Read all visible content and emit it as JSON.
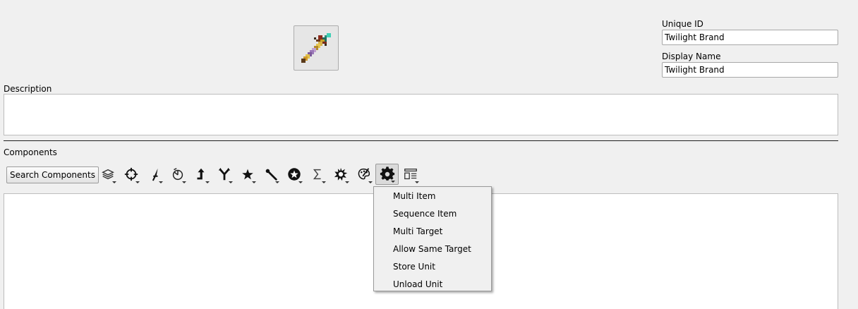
{
  "item": {
    "icon": "spear-sprite-icon",
    "unique_id_label": "Unique ID",
    "unique_id_value": "Twilight Brand",
    "display_name_label": "Display Name",
    "display_name_value": "Twilight Brand",
    "description_label": "Description",
    "description_value": ""
  },
  "components": {
    "label": "Components",
    "search_button": "Search Components",
    "toolbar_icons": [
      "layers-icon",
      "crosshair-icon",
      "sword-icon",
      "pie-clock-icon",
      "arrow-up-icon",
      "branch-icon",
      "star-icon",
      "staff-icon",
      "circle-star-icon",
      "sigma-icon",
      "burst-icon",
      "palette-icon",
      "gear-icon",
      "layout-icon"
    ],
    "active_tool": "gear-icon",
    "dropdown_menu": {
      "items": [
        "Multi Item",
        "Sequence Item",
        "Multi Target",
        "Allow Same Target",
        "Store Unit",
        "Unload Unit"
      ]
    }
  },
  "colors": {
    "background": "#f0f0f0",
    "input_background": "#ffffff",
    "border": "#a8a8a8",
    "divider": "#1e1e1e"
  }
}
